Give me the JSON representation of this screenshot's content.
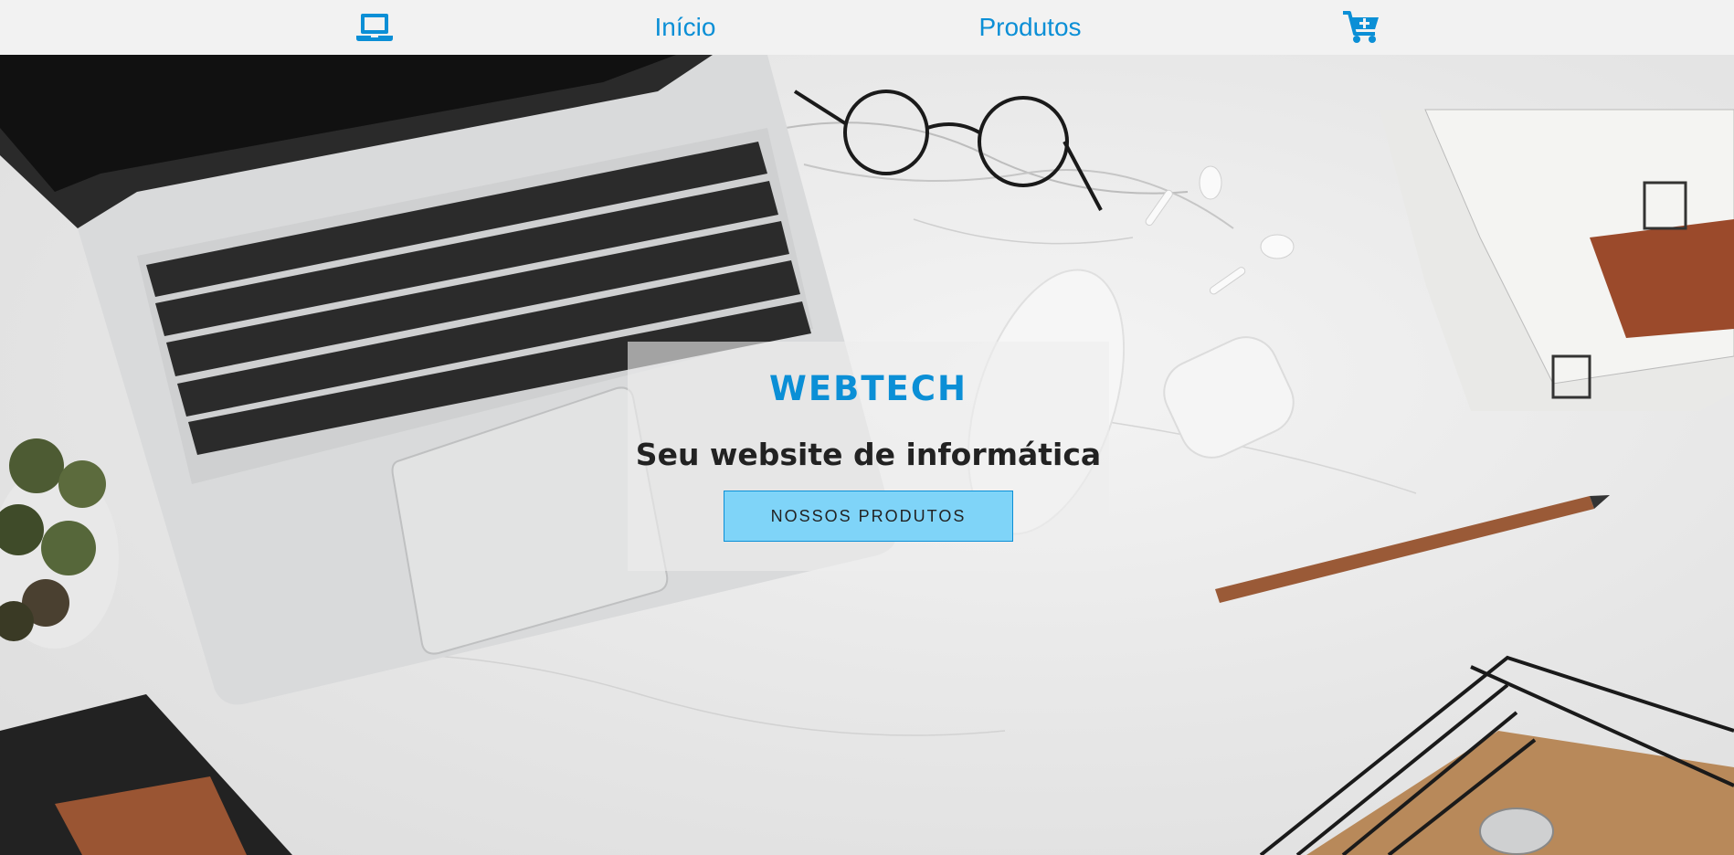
{
  "nav": {
    "logo_icon": "laptop-icon",
    "home_label": "Início",
    "products_label": "Produtos",
    "cart_icon": "cart-plus-icon",
    "accent_color": "#0b8fd6"
  },
  "hero": {
    "brand": "WEBTECH",
    "tagline": "Seu website de informática",
    "cta_label": "NOSSOS PRODUTOS",
    "cta_color": "#7fd4f8"
  }
}
